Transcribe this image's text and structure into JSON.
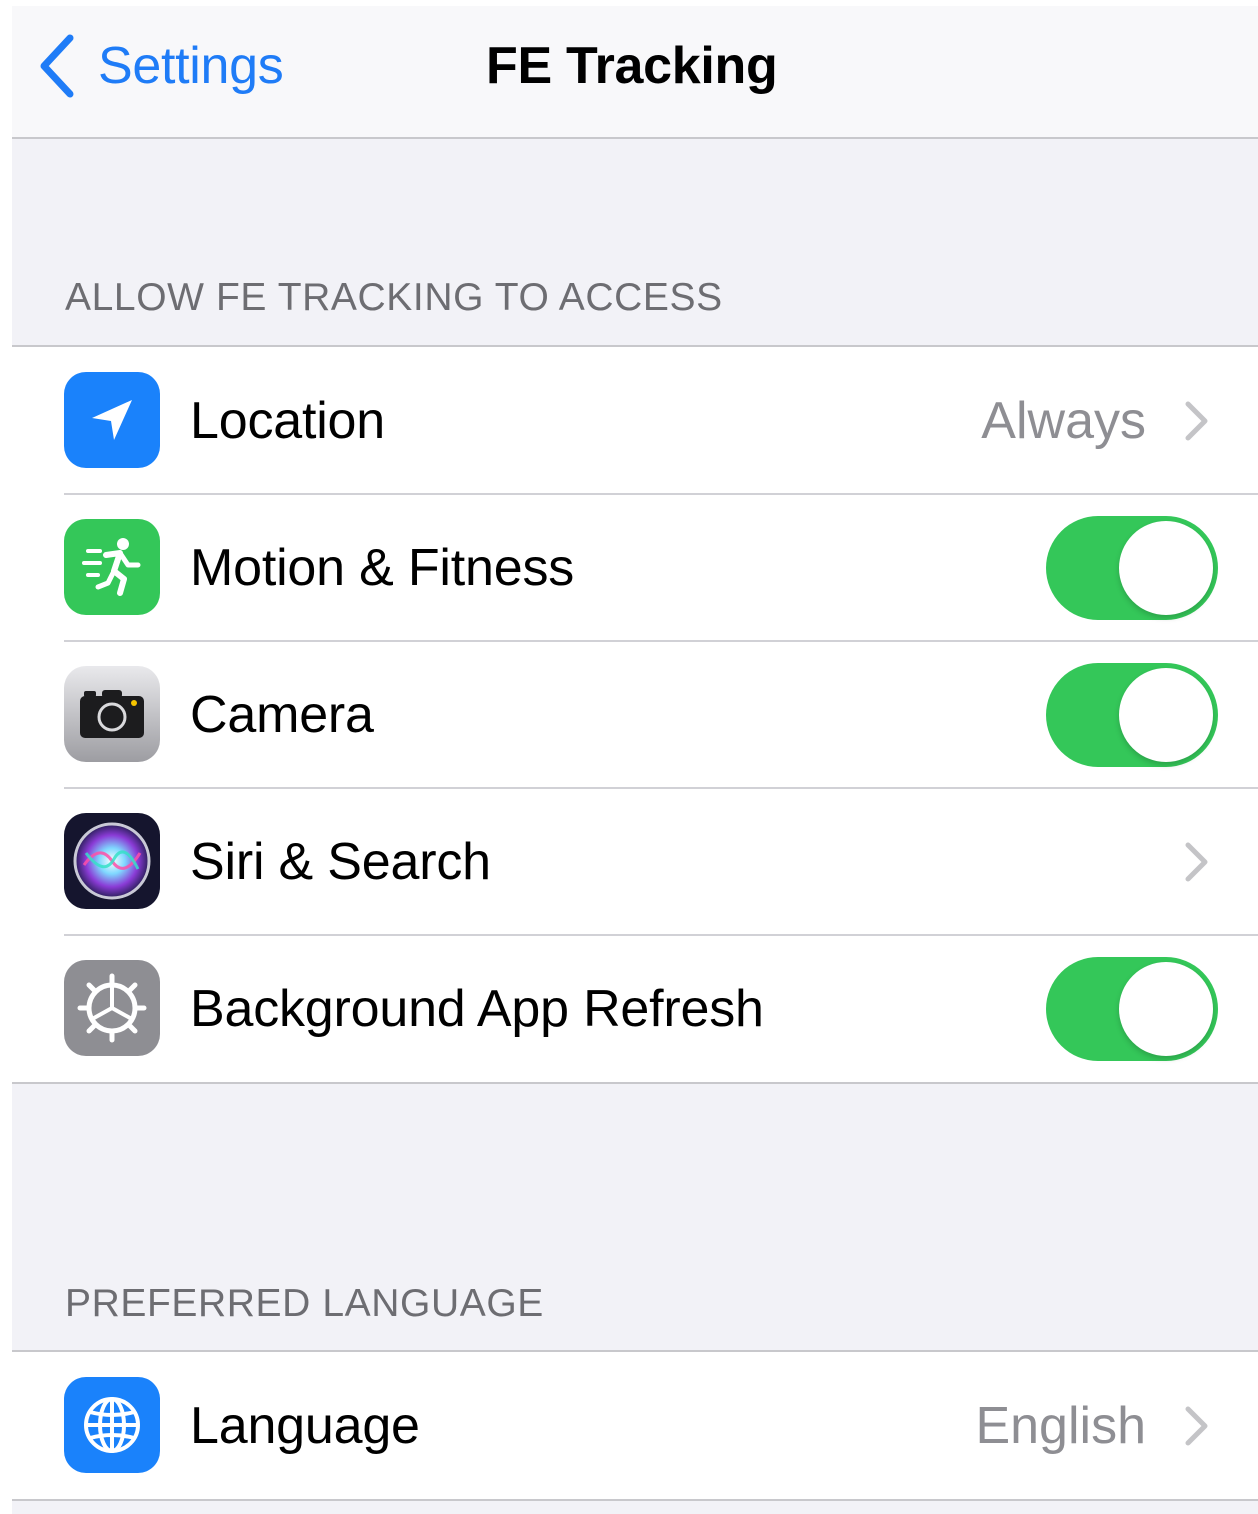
{
  "navbar": {
    "back_label": "Settings",
    "title": "FE Tracking"
  },
  "sections": [
    {
      "header": "ALLOW FE TRACKING TO ACCESS",
      "rows": [
        {
          "label": "Location",
          "value": "Always",
          "accessory": "chevron",
          "icon": "location-arrow-icon",
          "icon_color": "#1a82fb"
        },
        {
          "label": "Motion & Fitness",
          "accessory": "toggle",
          "on": true,
          "icon": "running-figure-icon",
          "icon_color": "#34c759"
        },
        {
          "label": "Camera",
          "accessory": "toggle",
          "on": true,
          "icon": "camera-icon",
          "icon_color": "#8e8e93"
        },
        {
          "label": "Siri & Search",
          "value": "",
          "accessory": "chevron",
          "icon": "siri-icon",
          "icon_color": "#1c1c3a"
        },
        {
          "label": "Background App Refresh",
          "accessory": "toggle",
          "on": true,
          "icon": "gear-icon",
          "icon_color": "#8e8e93"
        }
      ]
    },
    {
      "header": "PREFERRED LANGUAGE",
      "rows": [
        {
          "label": "Language",
          "value": "English",
          "accessory": "chevron",
          "icon": "globe-icon",
          "icon_color": "#1a82fb"
        }
      ]
    }
  ],
  "colors": {
    "accent": "#1f7cf7",
    "toggle_on": "#34c759",
    "background": "#f2f2f7"
  }
}
